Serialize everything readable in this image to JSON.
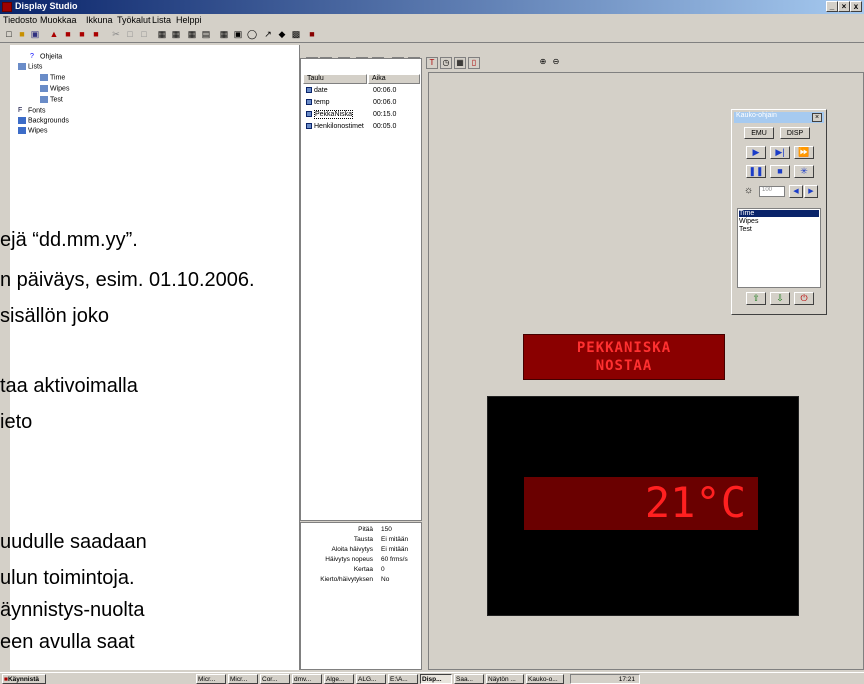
{
  "window": {
    "title": "Display Studio",
    "minimize": "_",
    "restore": "×",
    "close": "x"
  },
  "menu": [
    "Tiedosto",
    "Muokkaa",
    "Ikkuna",
    "Työkalut",
    "Lista",
    "Helppi"
  ],
  "tree": {
    "items": [
      {
        "label": "Ohjeita",
        "icon": "help-icon"
      },
      {
        "label": "Lists",
        "icon": "list-icon"
      },
      {
        "label": "Time",
        "icon": "list-item-icon"
      },
      {
        "label": "Wipes",
        "icon": "list-item-icon"
      },
      {
        "label": "Test",
        "icon": "list-item-icon"
      },
      {
        "label": "Fonts",
        "icon": "font-icon"
      },
      {
        "label": "Backgrounds",
        "icon": "background-icon"
      },
      {
        "label": "Wipes",
        "icon": "wipe-icon"
      }
    ]
  },
  "slide_lines": [
    "ejä “dd.mm.yy”.",
    "n päiväys, esim. 01.10.2006.",
    "sisällön joko",
    "taa aktivoimalla",
    "ieto",
    "uudulle saadaan",
    "ulun toimintoja.",
    "äynnistys-nuolta",
    "een avulla saat"
  ],
  "list": {
    "columns": [
      "Taulu",
      "Aika"
    ],
    "rows": [
      {
        "name": "date",
        "time": "00:06.0"
      },
      {
        "name": "temp",
        "time": "00:06.0"
      },
      {
        "name": "PekkaNiska",
        "time": "00:15.0"
      },
      {
        "name": "Henkilonostimet",
        "time": "00:05.0"
      }
    ]
  },
  "properties": [
    {
      "key": "Pitää",
      "value": "150"
    },
    {
      "key": "Tausta",
      "value": "Ei mitään"
    },
    {
      "key": "Aloita häivytys",
      "value": "Ei mitään"
    },
    {
      "key": "Häivytys nopeus",
      "value": "60 frms/s"
    },
    {
      "key": "Kertaa",
      "value": "0"
    },
    {
      "key": "Kierto/häivytyksen",
      "value": "No"
    }
  ],
  "display": {
    "small_line1": "PEKKANISKA",
    "small_line2": "NOSTAA",
    "temperature": "21°C",
    "colors": {
      "led": "#ff2020",
      "panel": "#6a0000"
    }
  },
  "remote": {
    "title": "Kauko-ohjain",
    "tabs": [
      "EMU",
      "DISP"
    ],
    "brightness": "100",
    "list": [
      "Time",
      "Wipes",
      "Test"
    ]
  },
  "taskbar": {
    "start": "Käynnistä",
    "tasks": [
      "Micr...",
      "Micr...",
      "Cor...",
      "dmv...",
      "Alge...",
      "ALG...",
      "E:\\A...",
      "Disp...",
      "Saa...",
      "Näytön ...",
      "Kauko-o..."
    ],
    "clock": "17:21"
  }
}
